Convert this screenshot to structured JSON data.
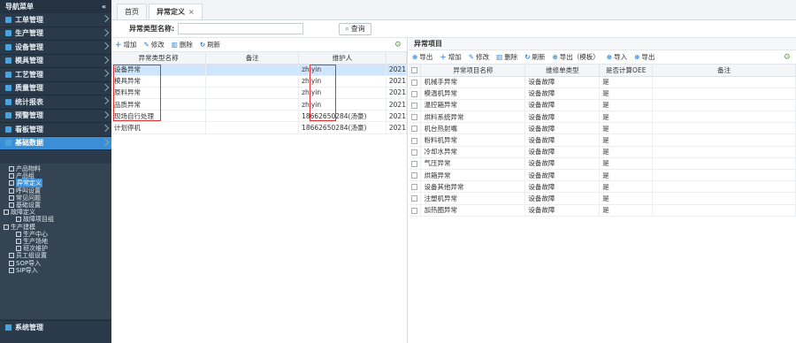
{
  "sidebar": {
    "title": "导航菜单",
    "collapse_icon": "«",
    "items": [
      {
        "label": "工单管理"
      },
      {
        "label": "生产管理"
      },
      {
        "label": "设备管理"
      },
      {
        "label": "模具管理"
      },
      {
        "label": "工艺管理"
      },
      {
        "label": "质量管理"
      },
      {
        "label": "统计报表"
      },
      {
        "label": "预警管理"
      },
      {
        "label": "看板管理"
      },
      {
        "label": "基础数据"
      }
    ],
    "tree": [
      {
        "label": "产品物料",
        "indent": 1
      },
      {
        "label": "产品组",
        "indent": 1
      },
      {
        "label": "异常定义",
        "indent": 1,
        "selected": true
      },
      {
        "label": "呼叫设置",
        "indent": 1
      },
      {
        "label": "常见问题",
        "indent": 1
      },
      {
        "label": "基础设置",
        "indent": 1
      },
      {
        "label": "故障定义",
        "indent": 0
      },
      {
        "label": "故障项目组",
        "indent": 2
      },
      {
        "label": "生产建模",
        "indent": 0
      },
      {
        "label": "生产中心",
        "indent": 2
      },
      {
        "label": "生产场地",
        "indent": 2
      },
      {
        "label": "班次维护",
        "indent": 2
      },
      {
        "label": "员工组设置",
        "indent": 1
      },
      {
        "label": "SOP导入",
        "indent": 1
      },
      {
        "label": "SIP导入",
        "indent": 1
      }
    ],
    "footer": "系统管理"
  },
  "tabs": [
    {
      "label": "首页"
    },
    {
      "label": "异常定义",
      "close": "×"
    }
  ],
  "search": {
    "label": "异常类型名称:",
    "value": "",
    "button": "查询"
  },
  "left_toolbar": {
    "add": "增加",
    "edit": "修改",
    "delete": "删除",
    "refresh": "刷新"
  },
  "left_table": {
    "headers": [
      "异常类型名称",
      "备注",
      "维护人",
      ""
    ],
    "rows": [
      [
        "设备异常",
        "",
        "zhiyin",
        "2021"
      ],
      [
        "模具异常",
        "",
        "zhiyin",
        "2021"
      ],
      [
        "原料异常",
        "",
        "zhiyin",
        "2021"
      ],
      [
        "品质异常",
        "",
        "zhiyin",
        "2021"
      ],
      [
        "现场自行处理",
        "",
        "18662650284(汤豪)",
        "2021"
      ],
      [
        "计划停机",
        "",
        "18662650284(汤豪)",
        "2021"
      ]
    ]
  },
  "right_panel": {
    "title": "异常项目",
    "toolbar": {
      "export": "导出",
      "add": "增加",
      "edit": "修改",
      "delete": "删除",
      "refresh": "刷新",
      "export_template": "导出（模板）",
      "import": "导入",
      "export2": "导出"
    },
    "headers": [
      "异常项目名称",
      "维修单类型",
      "是否计算OEE",
      "备注"
    ],
    "rows": [
      [
        "机械手异常",
        "设备故障",
        "是",
        ""
      ],
      [
        "模温机异常",
        "设备故障",
        "是",
        ""
      ],
      [
        "温控箱异常",
        "设备故障",
        "是",
        ""
      ],
      [
        "烘料系统异常",
        "设备故障",
        "是",
        ""
      ],
      [
        "机台热射嘴",
        "设备故障",
        "是",
        ""
      ],
      [
        "粉料机异常",
        "设备故障",
        "是",
        ""
      ],
      [
        "冷却水异常",
        "设备故障",
        "是",
        ""
      ],
      [
        "气压异常",
        "设备故障",
        "是",
        ""
      ],
      [
        "烘箱异常",
        "设备故障",
        "是",
        ""
      ],
      [
        "设备其他异常",
        "设备故障",
        "是",
        ""
      ],
      [
        "注塑机异常",
        "设备故障",
        "是",
        ""
      ],
      [
        "加热圈异常",
        "设备故障",
        "是",
        ""
      ]
    ]
  },
  "colors": {
    "sidebar_bg": "#2b3a4a",
    "accent": "#3a8fd6",
    "highlight_row": "#cfe5fb",
    "annotation_red": "#dd3333"
  }
}
